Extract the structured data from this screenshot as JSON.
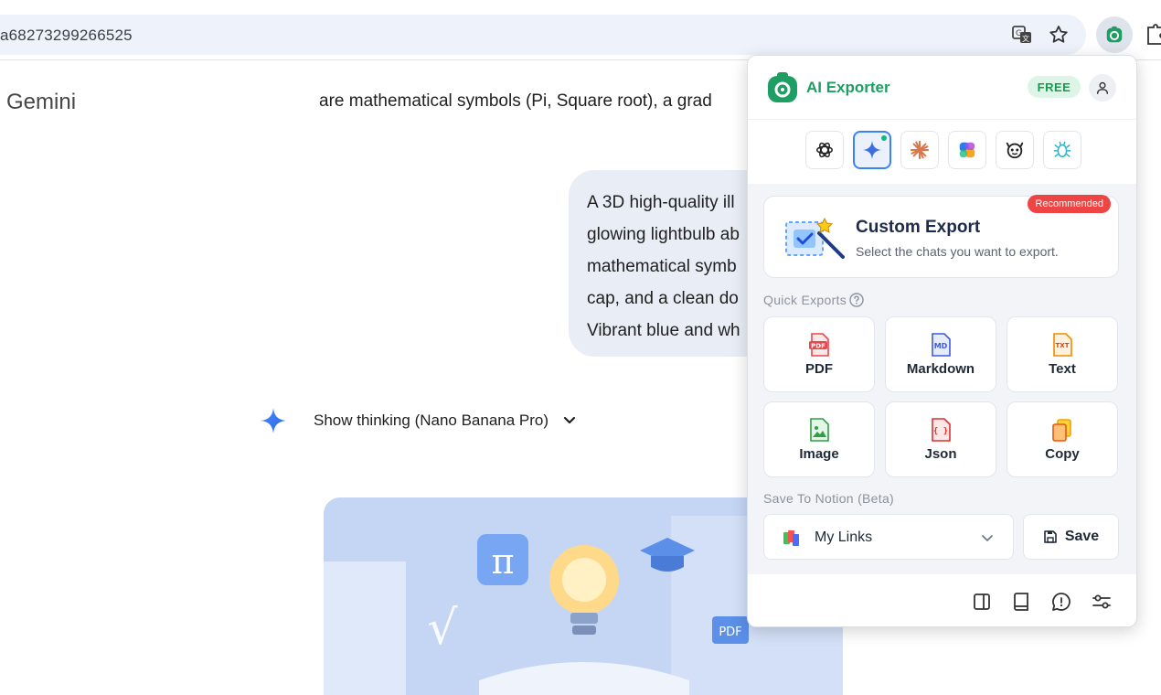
{
  "browser": {
    "url_fragment": "a68273299266525",
    "icons": [
      "translate-icon",
      "bookmark-star-icon",
      "extension-ai-exporter-icon",
      "extensions-puzzle-icon"
    ]
  },
  "page": {
    "title": "Gemini",
    "top_text": "are mathematical symbols (Pi, Square root), a grad",
    "prompt_lines": [
      "A 3D high-quality ill",
      "glowing lightbulb ab",
      "mathematical symb",
      "cap, and a clean do",
      "Vibrant blue and wh"
    ],
    "thinking_label": "Show thinking (Nano Banana Pro)",
    "image_labels": {
      "pi": "π",
      "root": "√",
      "pdf": "PDF"
    }
  },
  "popup": {
    "brand": "AI Exporter",
    "plan_badge": "FREE",
    "platforms": [
      {
        "name": "chatgpt",
        "active": false
      },
      {
        "name": "gemini",
        "active": true
      },
      {
        "name": "claude",
        "active": false
      },
      {
        "name": "copilot",
        "active": false
      },
      {
        "name": "grok",
        "active": false
      },
      {
        "name": "deepseek",
        "active": false
      }
    ],
    "custom_export": {
      "title": "Custom Export",
      "subtitle": "Select the chats you want to export.",
      "badge": "Recommended"
    },
    "quick_exports_label": "Quick Exports",
    "quick_exports": [
      {
        "label": "PDF",
        "icon": "pdf-file-icon",
        "icon_text": "PDF",
        "color": "#e5484d"
      },
      {
        "label": "Markdown",
        "icon": "markdown-file-icon",
        "icon_text": "MD",
        "color": "#3b5bdb"
      },
      {
        "label": "Text",
        "icon": "text-file-icon",
        "icon_text": "TXT",
        "color": "#f08c00"
      },
      {
        "label": "Image",
        "icon": "image-file-icon",
        "icon_text": "",
        "color": "#2f9e44"
      },
      {
        "label": "Json",
        "icon": "json-file-icon",
        "icon_text": "{ }",
        "color": "#e03131"
      },
      {
        "label": "Copy",
        "icon": "copy-icon",
        "icon_text": "",
        "color": "#f59f00"
      }
    ],
    "notion_label": "Save To Notion (Beta)",
    "notion_page": "My Links",
    "save_label": "Save",
    "footer_icons": [
      "sidebar-panel-icon",
      "book-icon",
      "feedback-icon",
      "settings-sliders-icon"
    ]
  },
  "colors": {
    "accent_green": "#1e9e63",
    "accent_blue": "#3b82f6",
    "badge_red": "#ef4444"
  }
}
